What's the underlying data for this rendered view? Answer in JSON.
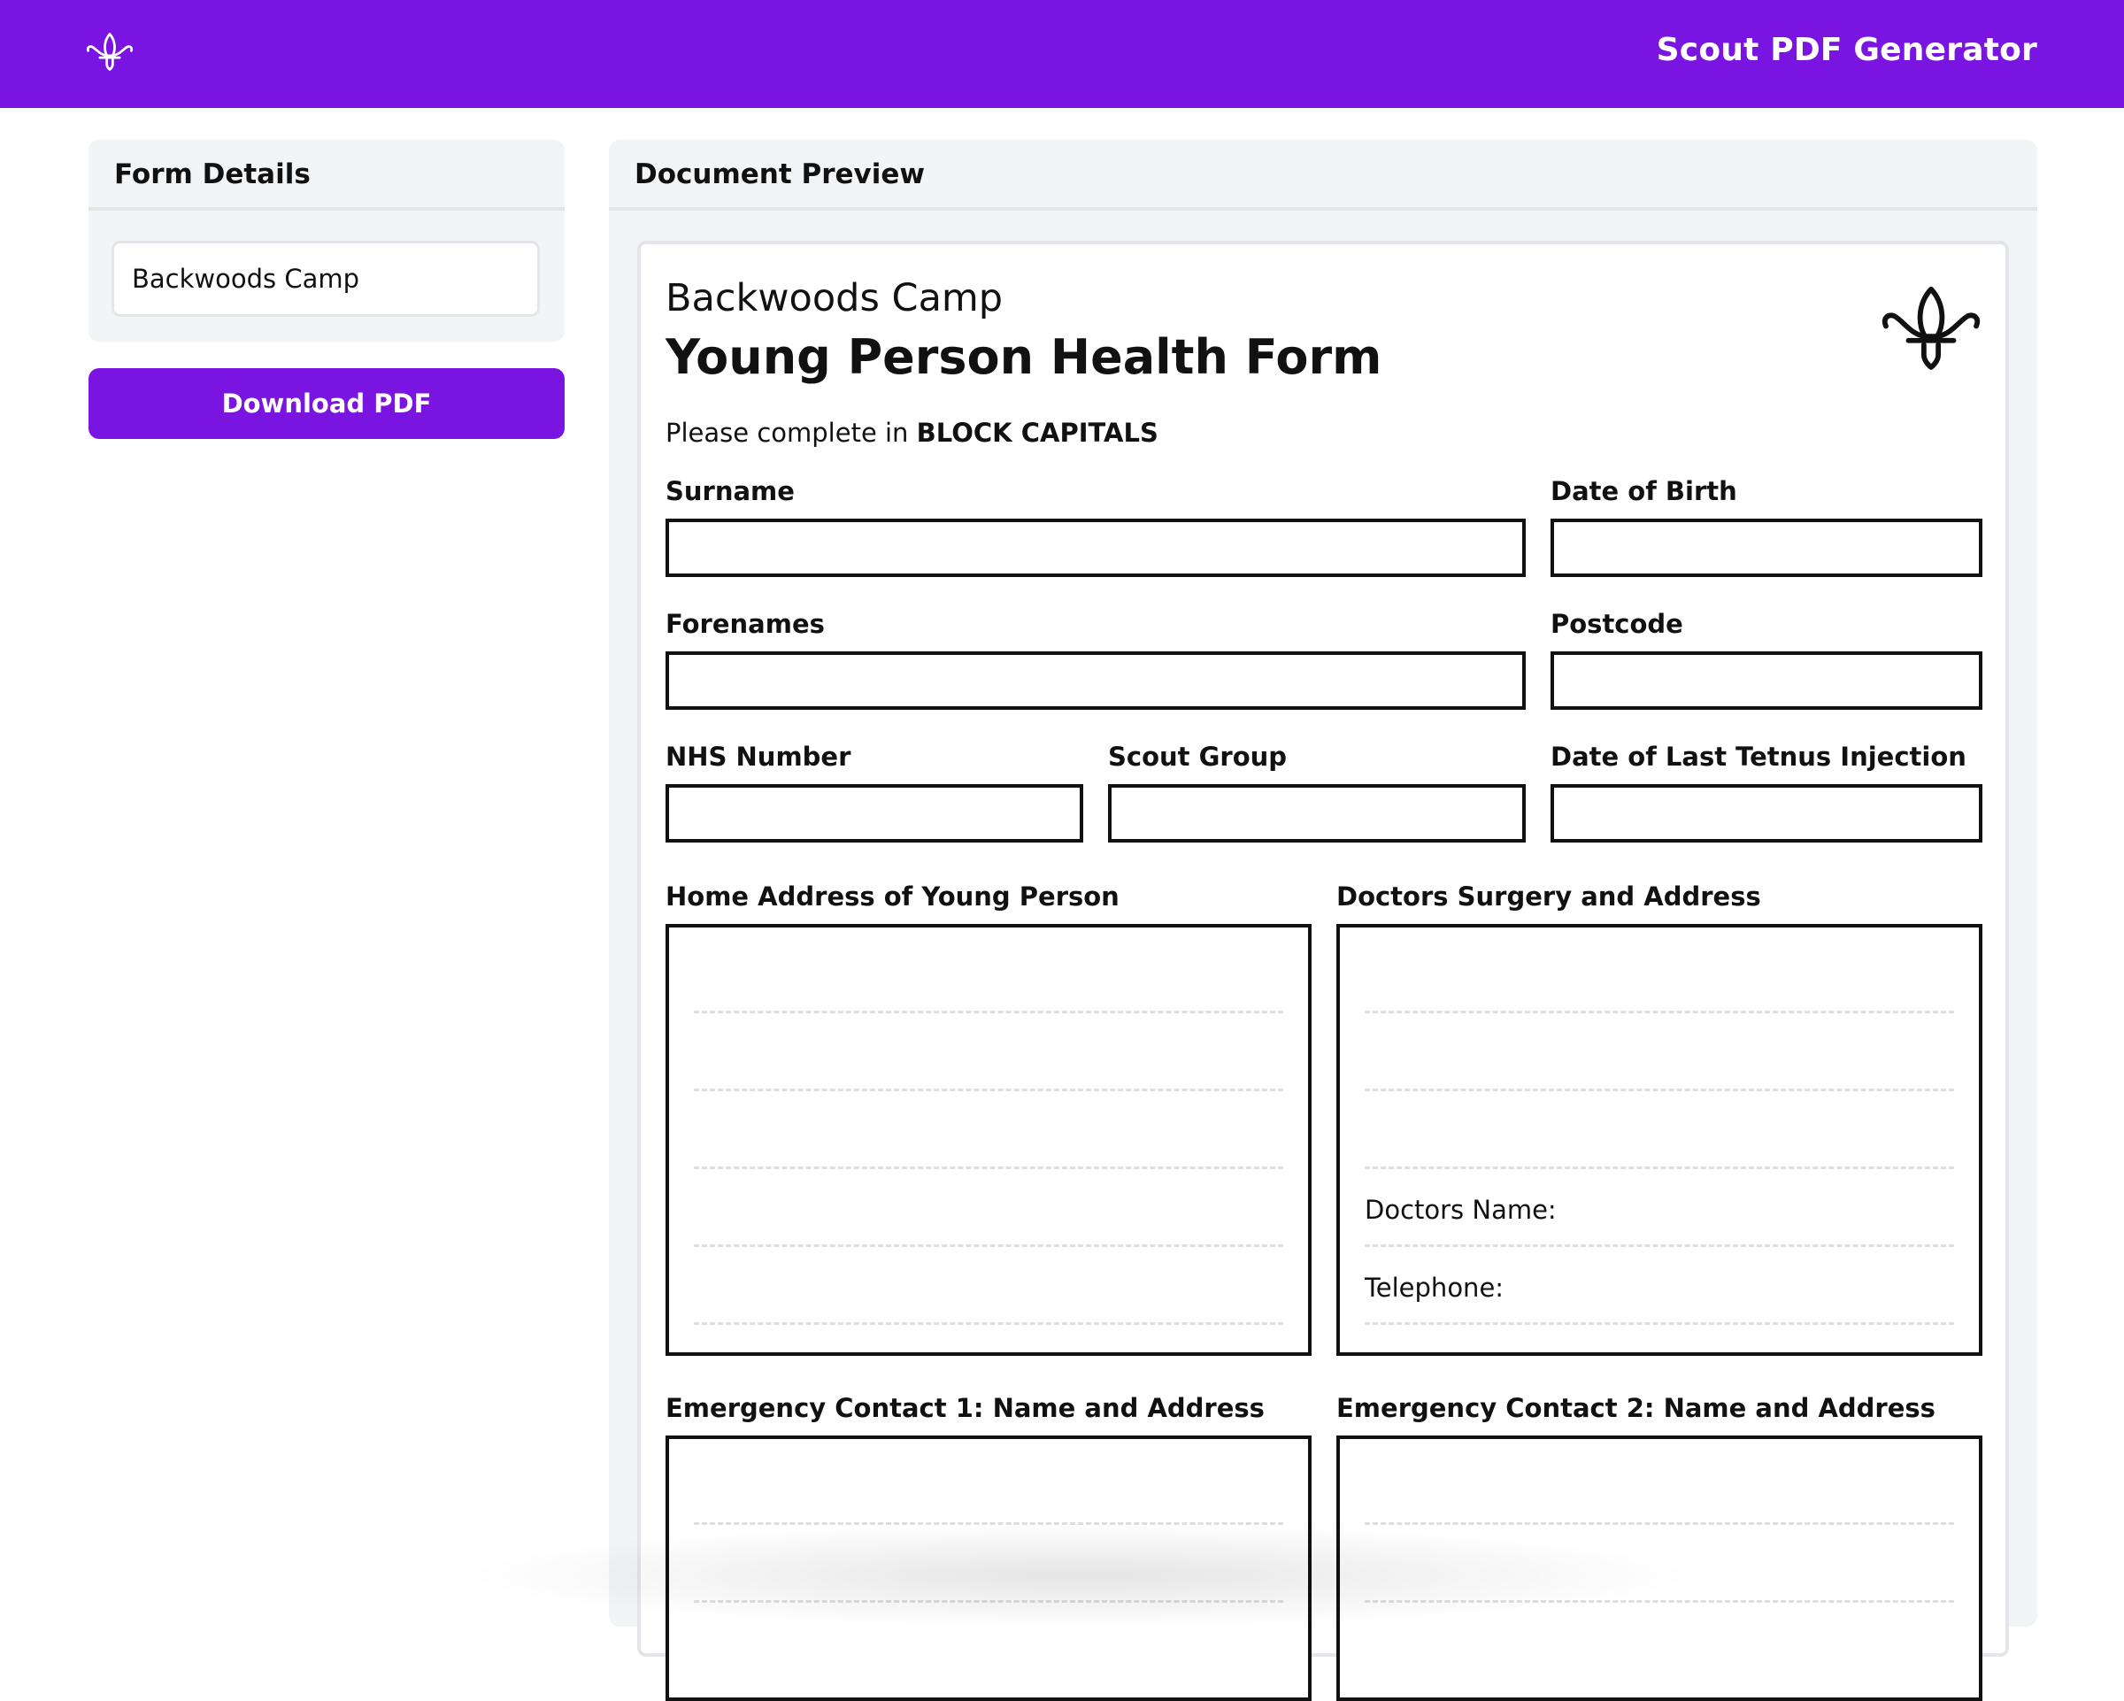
{
  "header": {
    "app_title": "Scout PDF Generator",
    "logo_icon": "fleur-de-lis-icon",
    "bar_color": "#7a14e0"
  },
  "form_details": {
    "title": "Form Details",
    "event_name_value": "Backwoods Camp",
    "download_label": "Download PDF"
  },
  "preview": {
    "title": "Document Preview",
    "doc": {
      "event_name": "Backwoods Camp",
      "form_title": "Young Person Health Form",
      "instruction_prefix": "Please complete in",
      "instruction_emphasis": "BLOCK CAPITALS",
      "logo_icon": "fleur-de-lis-icon",
      "fields": {
        "surname": "Surname",
        "date_of_birth": "Date of Birth",
        "forenames": "Forenames",
        "postcode": "Postcode",
        "nhs_number": "NHS Number",
        "scout_group": "Scout Group",
        "tetanus": "Date of Last Tetnus Injection",
        "home_address": "Home Address of Young Person",
        "doctors_surgery": "Doctors Surgery and Address",
        "doctors_name": "Doctors Name:",
        "telephone": "Telephone:",
        "emergency_1": "Emergency Contact 1: Name and Address",
        "emergency_2": "Emergency Contact 2: Name and Address"
      }
    }
  }
}
